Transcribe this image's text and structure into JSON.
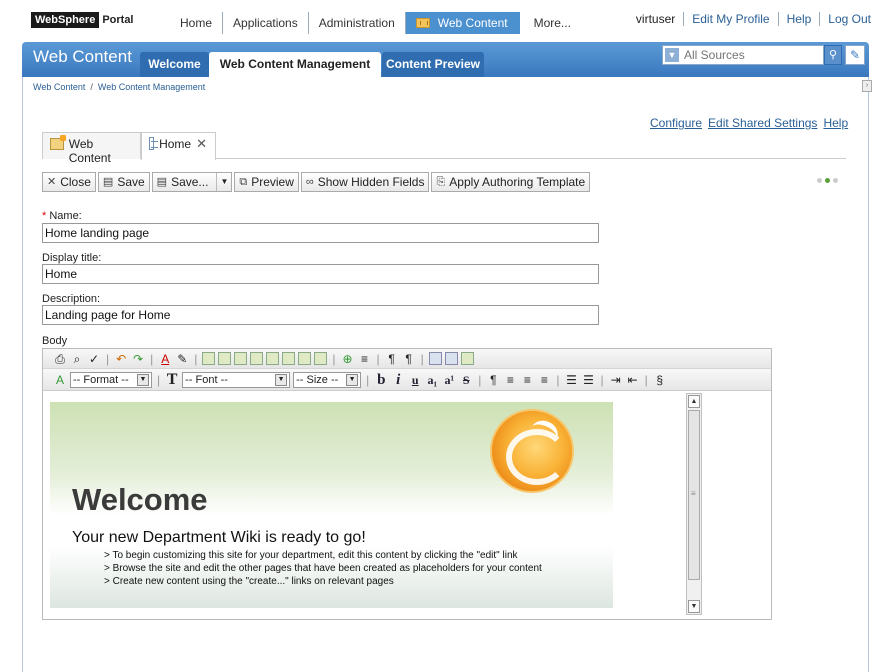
{
  "topbar": {
    "logo_brand": "WebSphere",
    "logo_product": "Portal",
    "nav": [
      "Home",
      "Applications",
      "Administration",
      "Web Content",
      "More..."
    ],
    "user": "virtuser",
    "user_links": [
      "Edit My Profile",
      "Help",
      "Log Out"
    ]
  },
  "header": {
    "title": "Web Content",
    "tabs": [
      "Welcome",
      "Web Content Management",
      "Content Preview"
    ],
    "search_placeholder": "All Sources"
  },
  "breadcrumb": [
    "Web Content",
    "Web Content Management"
  ],
  "portlet_links": [
    "Configure",
    "Edit Shared Settings",
    "Help"
  ],
  "inner_tabs": [
    "Web Content",
    "Home"
  ],
  "toolbar": {
    "close": "Close",
    "save": "Save",
    "save_menu": "Save...",
    "preview": "Preview",
    "show_hidden": "Show Hidden Fields",
    "apply_template": "Apply Authoring Template"
  },
  "form": {
    "name_label": "Name:",
    "name_value": "Home landing page",
    "display_title_label": "Display title:",
    "display_title_value": "Home",
    "description_label": "Description:",
    "description_value": "Landing page for Home",
    "body_label": "Body"
  },
  "editor": {
    "format_select": "-- Format --",
    "font_select": "-- Font --",
    "size_select": "-- Size --"
  },
  "body_content": {
    "heading": "Welcome",
    "tagline": "Your new Department Wiki is ready to go!",
    "bullets": [
      "> To begin customizing this site for your department, edit this content by clicking the \"edit\" link",
      "> Browse the site and edit the other pages that have been created as placeholders for your content",
      "> Create new content using the \"create...\" links on relevant pages"
    ]
  },
  "colors": {
    "accent": "#3a78bf",
    "link": "#2a5f95",
    "required": "#dd0000"
  }
}
